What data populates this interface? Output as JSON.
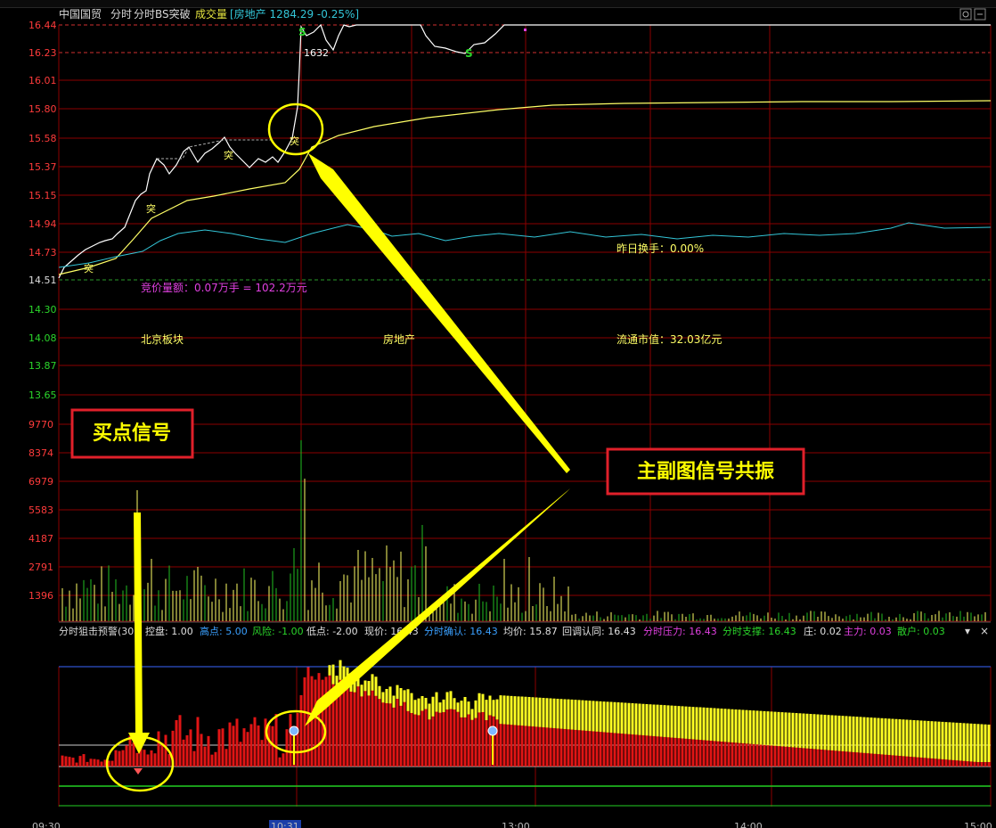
{
  "header": {
    "stock_name": "中国国贸",
    "mode_intraday": "分时",
    "indicator_name": "分时BS突破",
    "volume_label": "成交量",
    "sector_info": "[房地产 1284.29 -0.25%]"
  },
  "price_axis": [
    "16.44",
    "16.23",
    "16.01",
    "15.80",
    "15.58",
    "15.37",
    "15.15",
    "14.94",
    "14.73",
    "14.51",
    "14.30",
    "14.08",
    "13.87",
    "13.65"
  ],
  "volume_axis": [
    "9770",
    "8374",
    "6979",
    "5583",
    "4187",
    "2791",
    "1396"
  ],
  "time_axis": [
    "09:30",
    "10:31",
    "13:00",
    "14:00",
    "15:00"
  ],
  "main_chart": {
    "marker_high_price": "1632",
    "signal_tu": "突",
    "signal_s": "S",
    "prev_turnover": "昨日换手：0.00%",
    "auction_volume": "竞价量额：0.07万手 = 102.2万元",
    "region_block": "北京板块",
    "industry_block": "房地产",
    "float_market_cap": "流通市值：32.03亿元"
  },
  "sub_indicator": {
    "name": "分时狙击预警(30)",
    "kongpan": "控盘: 1.00",
    "gaodian": "高点: 5.00",
    "fengxian": "风险: -1.00",
    "didian": "低点: -2.00",
    "xianjia": "现价: 16.43",
    "fenshi_queren": "分时确认: 16.43",
    "junjia": "均价: 15.87",
    "huitiao_renting": "回调认同: 16.43",
    "fenshi_yali": "分时压力: 16.43",
    "fenshi_zhicheng": "分时支撑: 16.43",
    "zhuang": "庄: 0.02",
    "zhuli": "主力: 0.03",
    "sanhu": "散户: 0.03",
    "collapse_icon_label": "▾",
    "close_icon_label": "×"
  },
  "annotations": {
    "buy_signal": "买点信号",
    "resonance": "主副图信号共振"
  },
  "colors": {
    "price_up": "#ff3b3b",
    "price_down": "#2bd62b",
    "grid": "#8b0000",
    "price_line": "#ffffff",
    "avg_line": "#ffff66",
    "sector_line": "#33c6d8",
    "annotation_yellow": "#ffff00",
    "annotation_box": "#e0202a",
    "bar_red": "#e01515",
    "bar_yellow": "#ffff22"
  }
}
